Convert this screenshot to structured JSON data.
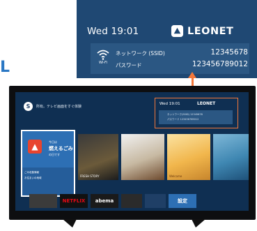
{
  "callout": {
    "day_time": "Wed 19:01",
    "brand": "LEONET",
    "wifi_tag": "Wi-Fi",
    "network_label": "ネットワーク (SSID)",
    "network_value": "12345678",
    "password_label": "パスワード",
    "password_value": "123456789012"
  },
  "side_letter": "L",
  "tv": {
    "user_initial": "S",
    "user_text": "所有。テレビ画面をすぐ体験",
    "info_time": "Wed 19:01",
    "info_brand": "LEONET",
    "info_line1": "ネットワーク(SSID) 12345678",
    "info_line2": "パスワード 123456789012",
    "featured_small": "今日は",
    "featured_title": "燃えるごみ",
    "featured_sub": "の日です",
    "featured_lower1": "ごみ収集情報",
    "featured_lower2": "お住まいの地域",
    "tile2_caption": "FRESH STORY",
    "tile3_caption": "",
    "tile4_caption": "Welcome",
    "tile5_caption": "",
    "apps": [
      "",
      "NETFLIX",
      "abema",
      "",
      "",
      "設定"
    ]
  },
  "colors": {
    "callout_bg": "#1f4873",
    "accent_orange": "#f4783a",
    "screen_bg": "#0f2f52",
    "featured_tile": "#2d6fb4"
  }
}
